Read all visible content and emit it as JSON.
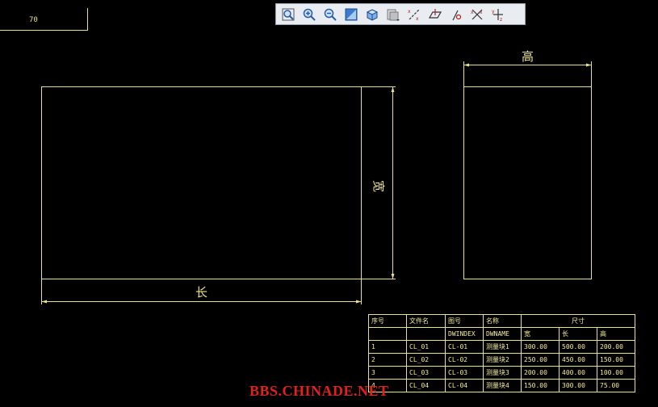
{
  "title_frame": {
    "text": "70"
  },
  "toolbar": {
    "buttons": [
      {
        "name": "zoom-fit",
        "icon": "zoom-fit-icon"
      },
      {
        "name": "zoom-in",
        "icon": "zoom-in-icon"
      },
      {
        "name": "zoom-out",
        "icon": "zoom-out-icon"
      },
      {
        "name": "refit",
        "icon": "refit-icon"
      },
      {
        "name": "shading",
        "icon": "cube-icon"
      },
      {
        "name": "saved-views",
        "icon": "saved-views-icon"
      },
      {
        "name": "datum-axes",
        "icon": "datum-axes-icon"
      },
      {
        "name": "datum-planes",
        "icon": "datum-planes-icon"
      },
      {
        "name": "datum-points",
        "icon": "datum-points-icon"
      },
      {
        "name": "datum-csys",
        "icon": "datum-csys-icon"
      },
      {
        "name": "annotation",
        "icon": "annotation-icon"
      }
    ]
  },
  "drawing": {
    "width_label": "宽",
    "length_label": "长",
    "height_label": "高"
  },
  "bom": {
    "headers": [
      "序号",
      "文件名",
      "图号",
      "名称",
      "尺寸"
    ],
    "subheaders": [
      "DWINDEX",
      "DWNAME",
      "宽",
      "长",
      "高"
    ],
    "rows": [
      [
        "1",
        "CL_01",
        "CL-01",
        "测量块1",
        "300.00",
        "500.00",
        "200.00"
      ],
      [
        "2",
        "CL_02",
        "CL-02",
        "测量块2",
        "250.00",
        "450.00",
        "150.00"
      ],
      [
        "3",
        "CL_03",
        "CL-03",
        "测量块3",
        "200.00",
        "400.00",
        "100.00"
      ],
      [
        "4",
        "CL_04",
        "CL-04",
        "测量块4",
        "150.00",
        "300.00",
        "75.00"
      ]
    ]
  },
  "watermark": "BBS.CHINADE.NET",
  "colors": {
    "line": "#e8e08a",
    "background": "#000000",
    "watermark": "#e2201d"
  }
}
